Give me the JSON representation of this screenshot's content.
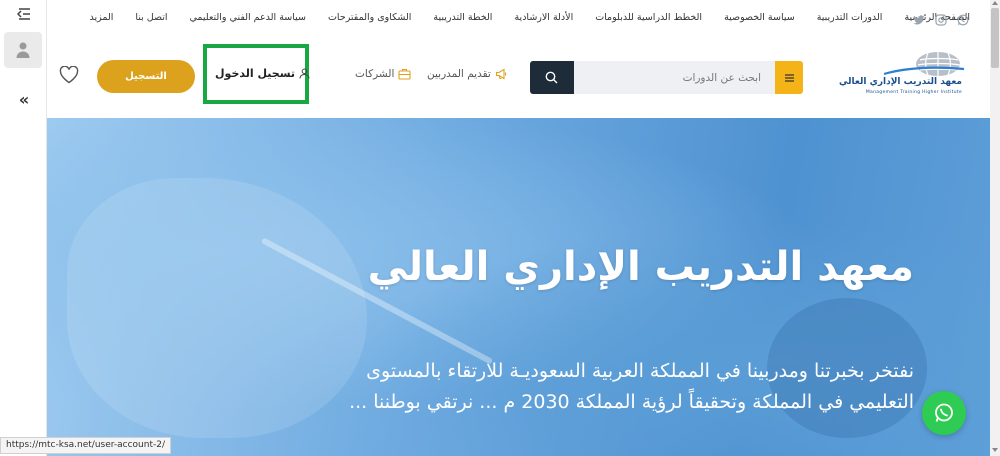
{
  "topnav": {
    "links": [
      "الصفحة الرئيسية",
      "الدورات التدريبية",
      "سياسة الخصوصية",
      "الخطط الدراسية للدبلومات",
      "الأدلة الارشادية",
      "الخطة التدريبية",
      "الشكاوى والمقترحات",
      "سياسة الدعم الفني والتعليمي",
      "اتصل بنا",
      "المزيد"
    ]
  },
  "header": {
    "register_label": "التسجيل",
    "login_label": "تسجيل الدخول",
    "companies_label": "الشركات",
    "trainers_label": "تقديم المدربين",
    "search_placeholder": "ابحث عن الدورات",
    "logo_ar": "معهد التدريب الإداري العالي",
    "logo_en": "Management Training Higher Institute"
  },
  "hero": {
    "title": "معهد التدريب الإداري العالي",
    "text": "نفتخر بخبرتنا ومدربينا في المملكة العربية السعوديـة للارتقاء بالمستوى التعليمي في المملكة وتحقيقاً لرؤية المملكة 2030 م ... نرتقي بوطننا ..."
  },
  "status_url": "https://mtc-ksa.net/user-account-2/",
  "colors": {
    "accent_gold": "#dca21e",
    "search_button": "#1e2b38",
    "menu_button": "#f4b417",
    "highlight_box": "#17a844",
    "whatsapp": "#2ecc52"
  }
}
